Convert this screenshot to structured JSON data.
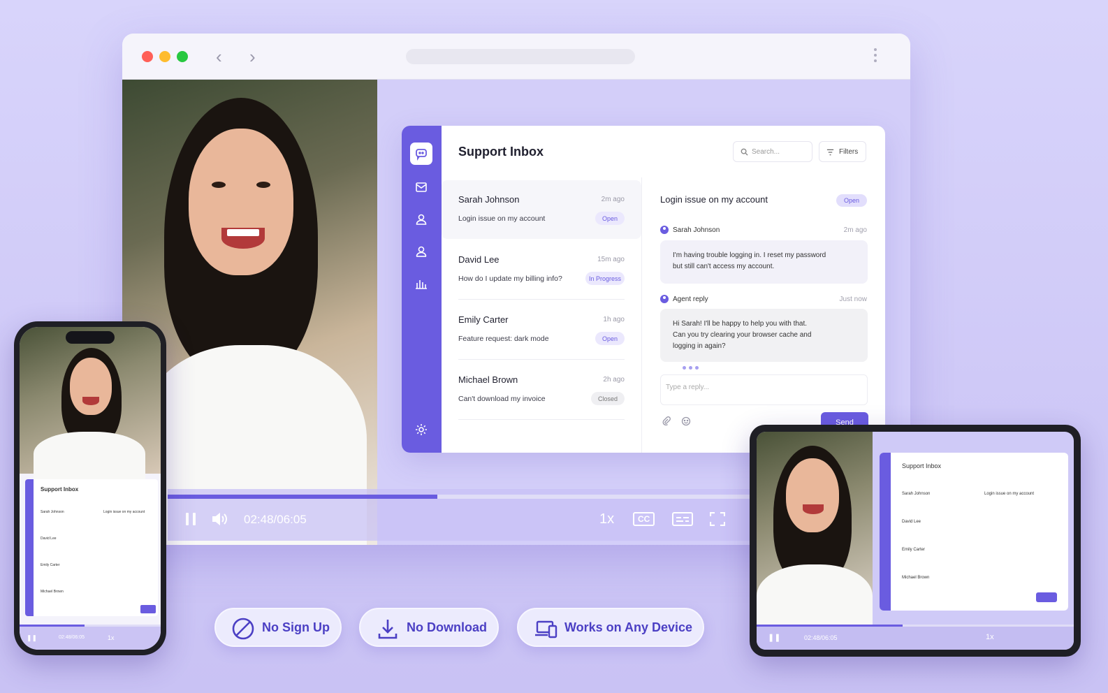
{
  "browser": {
    "traffic_lights": [
      "#ff5f57",
      "#febc2e",
      "#28c840"
    ],
    "nav": {
      "back_icon": "chevron-left-icon",
      "forward_icon": "chevron-right-icon"
    },
    "menu_icon": "kebab-menu-icon"
  },
  "app": {
    "title": "Support Inbox",
    "search_placeholder": "Search...",
    "filters_label": "Filters",
    "rail_icons": [
      "chat-logo-icon",
      "inbox-icon",
      "contact-icon",
      "user-icon",
      "analytics-icon",
      "settings-icon"
    ],
    "tickets": [
      {
        "name": "Sarah Johnson",
        "time": "2m ago",
        "subject": "Login issue on my account",
        "status": "Open"
      },
      {
        "name": "David Lee",
        "time": "15m ago",
        "subject": "How do I update my billing info?",
        "status": "In Progress"
      },
      {
        "name": "Emily Carter",
        "time": "1h ago",
        "subject": "Feature request: dark mode",
        "status": "Open"
      },
      {
        "name": "Michael Brown",
        "time": "2h ago",
        "subject": "Can't download my invoice",
        "status": "Closed"
      }
    ],
    "detail": {
      "title": "Login issue on my account",
      "status": "Open",
      "message1": {
        "author": "Sarah Johnson",
        "time": "2m ago",
        "text_line1": "I'm having trouble logging in. I reset my password",
        "text_line2": "but still can't access my account."
      },
      "message2": {
        "author": "Agent reply",
        "time": "Just now",
        "text_line1": "Hi Sarah! I'll be happy to help you with that.",
        "text_line2": "Can you try clearing your browser cache and",
        "text_line3": "logging in again?"
      },
      "reply_placeholder": "Type a reply...",
      "send_label": "Send"
    }
  },
  "player": {
    "time": "02:48/06:05",
    "progress": 0.46,
    "speed": "1x",
    "cc_label": "CC",
    "icons": [
      "pause-icon",
      "volume-icon",
      "captions-icon",
      "subtitles-icon",
      "fullscreen-icon"
    ]
  },
  "features": [
    {
      "label": "No Sign Up",
      "icon": "no-sign-icon"
    },
    {
      "label": "No Download",
      "icon": "download-icon"
    },
    {
      "label": "Works on Any Device",
      "icon": "devices-icon"
    }
  ],
  "colors": {
    "accent": "#6a5ce0",
    "background": "#d3cef9"
  }
}
